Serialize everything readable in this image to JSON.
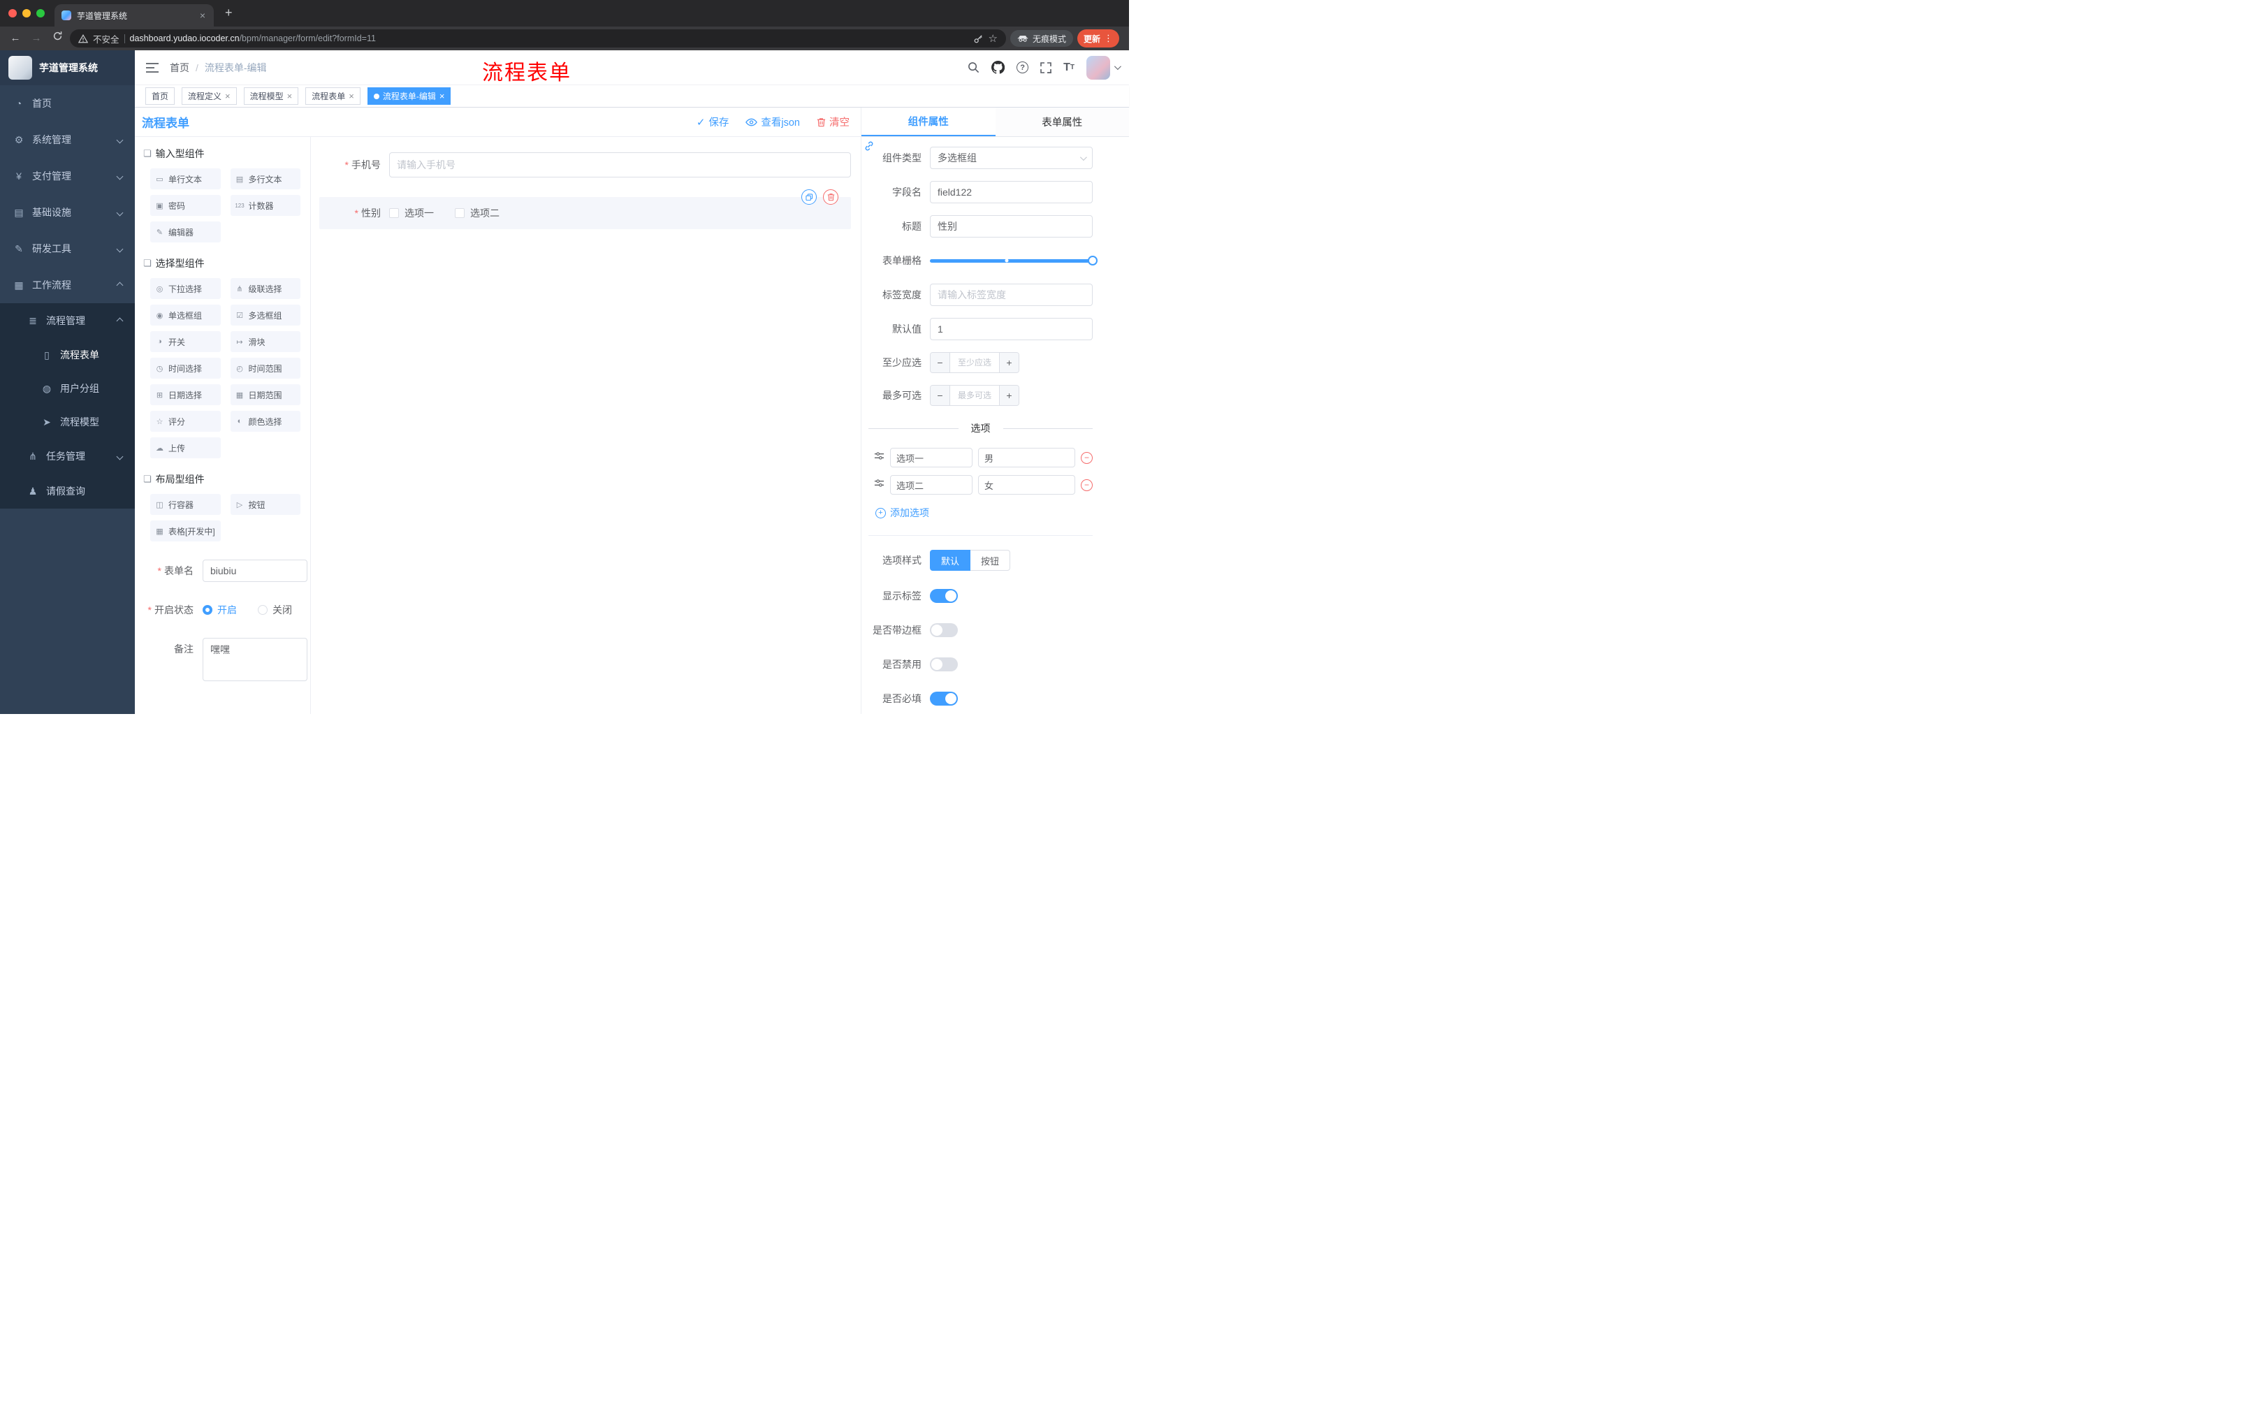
{
  "colors": {
    "accent": "#409eff",
    "danger": "#f56c6c",
    "sidebar_bg": "#304156",
    "sidebar_submenu_bg": "#1f2d3d",
    "active_tag_bg": "#409eff",
    "update_pill": "#e8553d",
    "annotation_red": "#ff0000"
  },
  "glyphs": {
    "back": "←",
    "forward": "→",
    "close": "×",
    "plus": "+",
    "minus": "−",
    "check": "✓",
    "question": "?",
    "kebab": "⋮",
    "star": "☆",
    "font_large": "T",
    "font_small": "T"
  },
  "browser": {
    "tab_title": "芋道管理系统",
    "security_text": "不安全",
    "url_host": "dashboard.yudao.iocoder.cn",
    "url_path": "/bpm/manager/form/edit?formId=11",
    "incognito_text": "无痕模式",
    "update_text": "更新"
  },
  "sidebar": {
    "logo_title": "芋道管理系统",
    "items": [
      {
        "label": "首页",
        "icon": "◔"
      },
      {
        "label": "系统管理",
        "icon": "⚙"
      },
      {
        "label": "支付管理",
        "icon": "¥"
      },
      {
        "label": "基础设施",
        "icon": "▤"
      },
      {
        "label": "研发工具",
        "icon": "✎"
      },
      {
        "label": "工作流程",
        "icon": "▦"
      },
      {
        "label": "流程管理",
        "icon": "≣"
      },
      {
        "label": "流程表单",
        "icon": "▯"
      },
      {
        "label": "用户分组",
        "icon": "◍"
      },
      {
        "label": "流程模型",
        "icon": "➤"
      },
      {
        "label": "任务管理",
        "icon": "⋔"
      },
      {
        "label": "请假查询",
        "icon": "♟"
      }
    ]
  },
  "header": {
    "breadcrumb_home": "首页",
    "breadcrumb_sep": "/",
    "breadcrumb_current": "流程表单-编辑",
    "annotation": "流程表单"
  },
  "tags": [
    {
      "label": "首页"
    },
    {
      "label": "流程定义"
    },
    {
      "label": "流程模型"
    },
    {
      "label": "流程表单"
    },
    {
      "label": "流程表单-编辑"
    }
  ],
  "designer": {
    "title": "流程表单",
    "save": "保存",
    "view_json": "查看json",
    "clear": "清空",
    "groups": [
      {
        "title": "输入型组件",
        "icon": "❏",
        "items": [
          {
            "label": "单行文本",
            "icon": "▭"
          },
          {
            "label": "多行文本",
            "icon": "▤"
          },
          {
            "label": "密码",
            "icon": "▣"
          },
          {
            "label": "计数器",
            "icon": "123"
          },
          {
            "label": "编辑器",
            "icon": "✎"
          }
        ]
      },
      {
        "title": "选择型组件",
        "icon": "❏",
        "items": [
          {
            "label": "下拉选择",
            "icon": "◎"
          },
          {
            "label": "级联选择",
            "icon": "⋔"
          },
          {
            "label": "单选框组",
            "icon": "◉"
          },
          {
            "label": "多选框组",
            "icon": "☑"
          },
          {
            "label": "开关",
            "icon": "◑"
          },
          {
            "label": "滑块",
            "icon": "↦"
          },
          {
            "label": "时间选择",
            "icon": "◷"
          },
          {
            "label": "时间范围",
            "icon": "◴"
          },
          {
            "label": "日期选择",
            "icon": "⊞"
          },
          {
            "label": "日期范围",
            "icon": "▦"
          },
          {
            "label": "评分",
            "icon": "☆"
          },
          {
            "label": "颜色选择",
            "icon": "◐"
          },
          {
            "label": "上传",
            "icon": "☁"
          }
        ]
      },
      {
        "title": "布局型组件",
        "icon": "❏",
        "items": [
          {
            "label": "行容器",
            "icon": "◫"
          },
          {
            "label": "按钮",
            "icon": "▷"
          },
          {
            "label": "表格[开发中]",
            "icon": "▦"
          }
        ]
      }
    ],
    "meta": {
      "form_name_label": "表单名",
      "form_name_value": "biubiu",
      "status_label": "开启状态",
      "status_on": "开启",
      "status_off": "关闭",
      "remark_label": "备注",
      "remark_value": "嘿嘿"
    },
    "canvas": {
      "phone_label": "手机号",
      "phone_placeholder": "请输入手机号",
      "gender_label": "性别",
      "gender_opt1": "选项一",
      "gender_opt2": "选项二"
    }
  },
  "props": {
    "tab_component": "组件属性",
    "tab_form": "表单属性",
    "component_type_label": "组件类型",
    "component_type_value": "多选框组",
    "field_name_label": "字段名",
    "field_name_value": "field122",
    "title_label": "标题",
    "title_value": "性别",
    "grid_label": "表单栅格",
    "label_width_label": "标签宽度",
    "label_width_placeholder": "请输入标签宽度",
    "default_label": "默认值",
    "default_value": "1",
    "min_label": "至少应选",
    "min_placeholder": "至少应选",
    "max_label": "最多可选",
    "max_placeholder": "最多可选",
    "options_title": "选项",
    "options": [
      {
        "label": "选项一",
        "value": "男"
      },
      {
        "label": "选项二",
        "value": "女"
      }
    ],
    "add_option": "添加选项",
    "style_label": "选项样式",
    "style_default": "默认",
    "style_button": "按钮",
    "show_label": "显示标签",
    "border_label": "是否带边框",
    "disabled_label": "是否禁用",
    "required_label": "是否必填"
  }
}
